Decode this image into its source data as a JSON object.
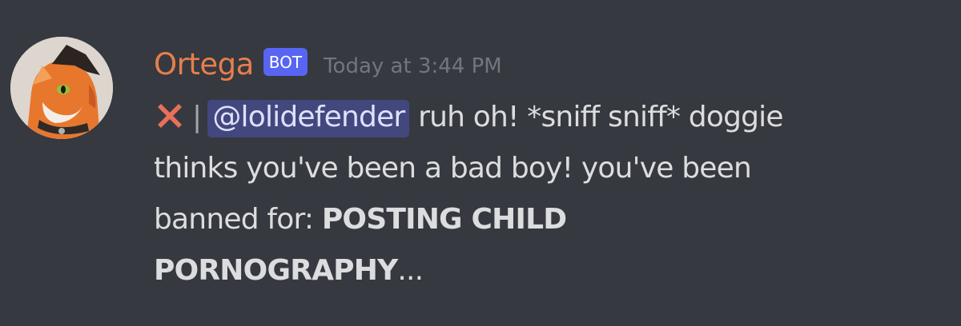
{
  "author": {
    "name": "Ortega",
    "bot_tag": "BOT",
    "timestamp": "Today at 3:44 PM",
    "name_color": "#e67e4d"
  },
  "message": {
    "icon": "cross-mark-icon",
    "separator": "|",
    "mention": "@lolidefender",
    "line1_text": "ruh oh! *sniff sniff* doggie",
    "line2_text": "thinks you've been a bad boy! you've been",
    "line3_text": "banned for:",
    "reason_part1": "POSTING CHILD",
    "reason_part2": "PORNOGRAPHY",
    "ellipsis": "..."
  },
  "colors": {
    "background": "#36393f",
    "bot_tag": "#5865f2",
    "mention_bg": "#4a4f8c"
  }
}
